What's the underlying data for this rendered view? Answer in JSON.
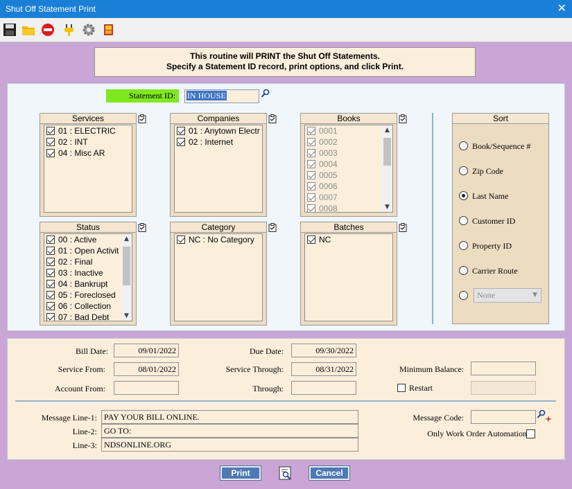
{
  "window": {
    "title": "Shut Off Statement Print",
    "close_label": "✕"
  },
  "toolbar": {
    "icons": [
      "save-icon",
      "open-folder-icon",
      "stop-icon",
      "plug-icon",
      "gear-icon",
      "book-icon"
    ]
  },
  "banner": {
    "line1": "This routine will PRINT the Shut Off Statements.",
    "line2": "Specify a Statement ID record, print options, and click Print."
  },
  "statement": {
    "label": "Statement ID:",
    "value": "IN HOUSE"
  },
  "services": {
    "title": "Services",
    "items": [
      {
        "label": "01 : ELECTRIC",
        "checked": true
      },
      {
        "label": "02 : INT",
        "checked": true
      },
      {
        "label": "04 : Misc AR",
        "checked": true
      }
    ]
  },
  "companies": {
    "title": "Companies",
    "items": [
      {
        "label": "01 : Anytown Electr",
        "checked": true
      },
      {
        "label": "02 : Internet",
        "checked": true
      }
    ]
  },
  "books": {
    "title": "Books",
    "items": [
      {
        "label": "0001",
        "checked": true
      },
      {
        "label": "0002",
        "checked": true
      },
      {
        "label": "0003",
        "checked": true
      },
      {
        "label": "0004",
        "checked": true
      },
      {
        "label": "0005",
        "checked": true
      },
      {
        "label": "0006",
        "checked": true
      },
      {
        "label": "0007",
        "checked": true
      },
      {
        "label": "0008",
        "checked": true
      }
    ]
  },
  "status": {
    "title": "Status",
    "items": [
      {
        "label": "00 : Active",
        "checked": true
      },
      {
        "label": "01 : Open Activit",
        "checked": true
      },
      {
        "label": "02 : Final",
        "checked": true
      },
      {
        "label": "03 : Inactive",
        "checked": true
      },
      {
        "label": "04 : Bankrupt",
        "checked": true
      },
      {
        "label": "05 : Foreclosed",
        "checked": true
      },
      {
        "label": "06 : Collection",
        "checked": true
      },
      {
        "label": "07 : Bad Debt",
        "checked": true
      }
    ]
  },
  "category": {
    "title": "Category",
    "items": [
      {
        "label": "NC : No Category",
        "checked": true
      }
    ]
  },
  "batches": {
    "title": "Batches",
    "items": [
      {
        "label": "NC",
        "checked": true
      }
    ]
  },
  "sort": {
    "title": "Sort",
    "options": [
      {
        "label": "Book/Sequence #",
        "selected": false
      },
      {
        "label": "Zip Code",
        "selected": false
      },
      {
        "label": "Last Name",
        "selected": true
      },
      {
        "label": "Customer ID",
        "selected": false
      },
      {
        "label": "Property ID",
        "selected": false
      },
      {
        "label": "Carrier Route",
        "selected": false
      },
      {
        "label": "",
        "selected": false
      }
    ],
    "select_value": "None"
  },
  "fields": {
    "bill_date_label": "Bill Date:",
    "bill_date": "09/01/2022",
    "due_date_label": "Due Date:",
    "due_date": "09/30/2022",
    "service_from_label": "Service From:",
    "service_from": "08/01/2022",
    "service_through_label": "Service Through:",
    "service_through": "08/31/2022",
    "min_balance_label": "Minimum Balance:",
    "min_balance": "",
    "account_from_label": "Account From:",
    "account_from": "",
    "through_label": "Through:",
    "through": "",
    "restart_label": "Restart",
    "restart_value": ""
  },
  "messages": {
    "line1_label": "Message Line-1:",
    "line1": "PAY YOUR BILL ONLINE.",
    "line2_label": "Line-2:",
    "line2": "GO TO:",
    "line3_label": "Line-3:",
    "line3": "NDSONLINE.ORG",
    "code_label": "Message Code:",
    "code": "",
    "work_order_label": "Only Work Order Automation"
  },
  "buttons": {
    "print": "Print",
    "cancel": "Cancel"
  }
}
